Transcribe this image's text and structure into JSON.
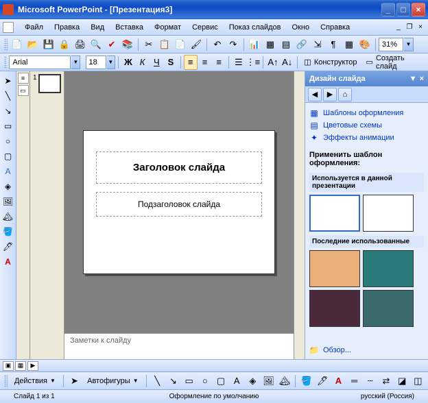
{
  "window": {
    "title": "Microsoft PowerPoint - [Презентация3]"
  },
  "menu": {
    "file": "Файл",
    "edit": "Правка",
    "view": "Вид",
    "insert": "Вставка",
    "format": "Формат",
    "tools": "Сервис",
    "slideshow": "Показ слайдов",
    "window": "Окно",
    "help": "Справка"
  },
  "format_toolbar": {
    "font": "Arial",
    "size": "18",
    "designer_label": "Конструктор",
    "new_slide_label": "Создать слайд",
    "zoom": "31%"
  },
  "thumbnails": {
    "slide1_num": "1"
  },
  "slide": {
    "title_placeholder": "Заголовок слайда",
    "subtitle_placeholder": "Подзаголовок слайда"
  },
  "notes": {
    "placeholder": "Заметки к слайду"
  },
  "taskpane": {
    "title": "Дизайн слайда",
    "link_templates": "Шаблоны оформления",
    "link_colors": "Цветовые схемы",
    "link_animation": "Эффекты анимации",
    "apply_label": "Применить шаблон оформления:",
    "used_in_label": "Используется в данной презентации",
    "recent_label": "Последние использованные",
    "browse": "Обзор..."
  },
  "drawbar": {
    "actions": "Действия",
    "autoshapes": "Автофигуры"
  },
  "status": {
    "slide": "Слайд 1 из 1",
    "design": "Оформление по умолчанию",
    "lang": "русский (Россия)"
  }
}
